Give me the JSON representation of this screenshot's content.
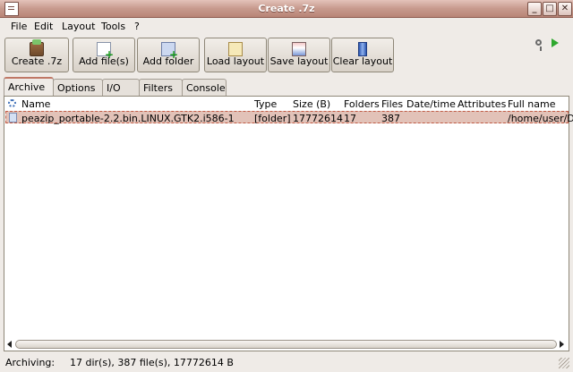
{
  "window": {
    "title": "Create .7z"
  },
  "menu": [
    "File",
    "Edit",
    "Layout",
    "Tools",
    "?"
  ],
  "toolbar": [
    {
      "label": "Create .7z",
      "icon": "archive-create-icon"
    },
    {
      "label": "Add file(s)",
      "icon": "add-file-icon"
    },
    {
      "label": "Add folder",
      "icon": "add-folder-icon"
    },
    {
      "label": "Load layout",
      "icon": "load-layout-icon"
    },
    {
      "label": "Save layout",
      "icon": "save-layout-icon"
    },
    {
      "label": "Clear layout",
      "icon": "clear-layout-icon"
    }
  ],
  "tabs": [
    "Archive",
    "Options",
    "I/O",
    "Filters",
    "Console"
  ],
  "active_tab": "Archive",
  "columns": [
    "Name",
    "Type",
    "Size (B)",
    "Folders",
    "Files",
    "Date/time",
    "Attributes",
    "Full name"
  ],
  "rows": [
    {
      "name": "peazip_portable-2.2.bin.LINUX.GTK2.i586-1",
      "type": "[folder]",
      "size": "17772614",
      "folders": "17",
      "files": "387",
      "datetime": "",
      "attributes": "",
      "fullname": "/home/user/D"
    }
  ],
  "status": {
    "label": "Archiving:",
    "text": "17 dir(s), 387 file(s), 17772614 B"
  },
  "colors": {
    "titlebar": "#c79a8e",
    "selection": "#e2c2b8",
    "selection_border": "#c05a44"
  }
}
